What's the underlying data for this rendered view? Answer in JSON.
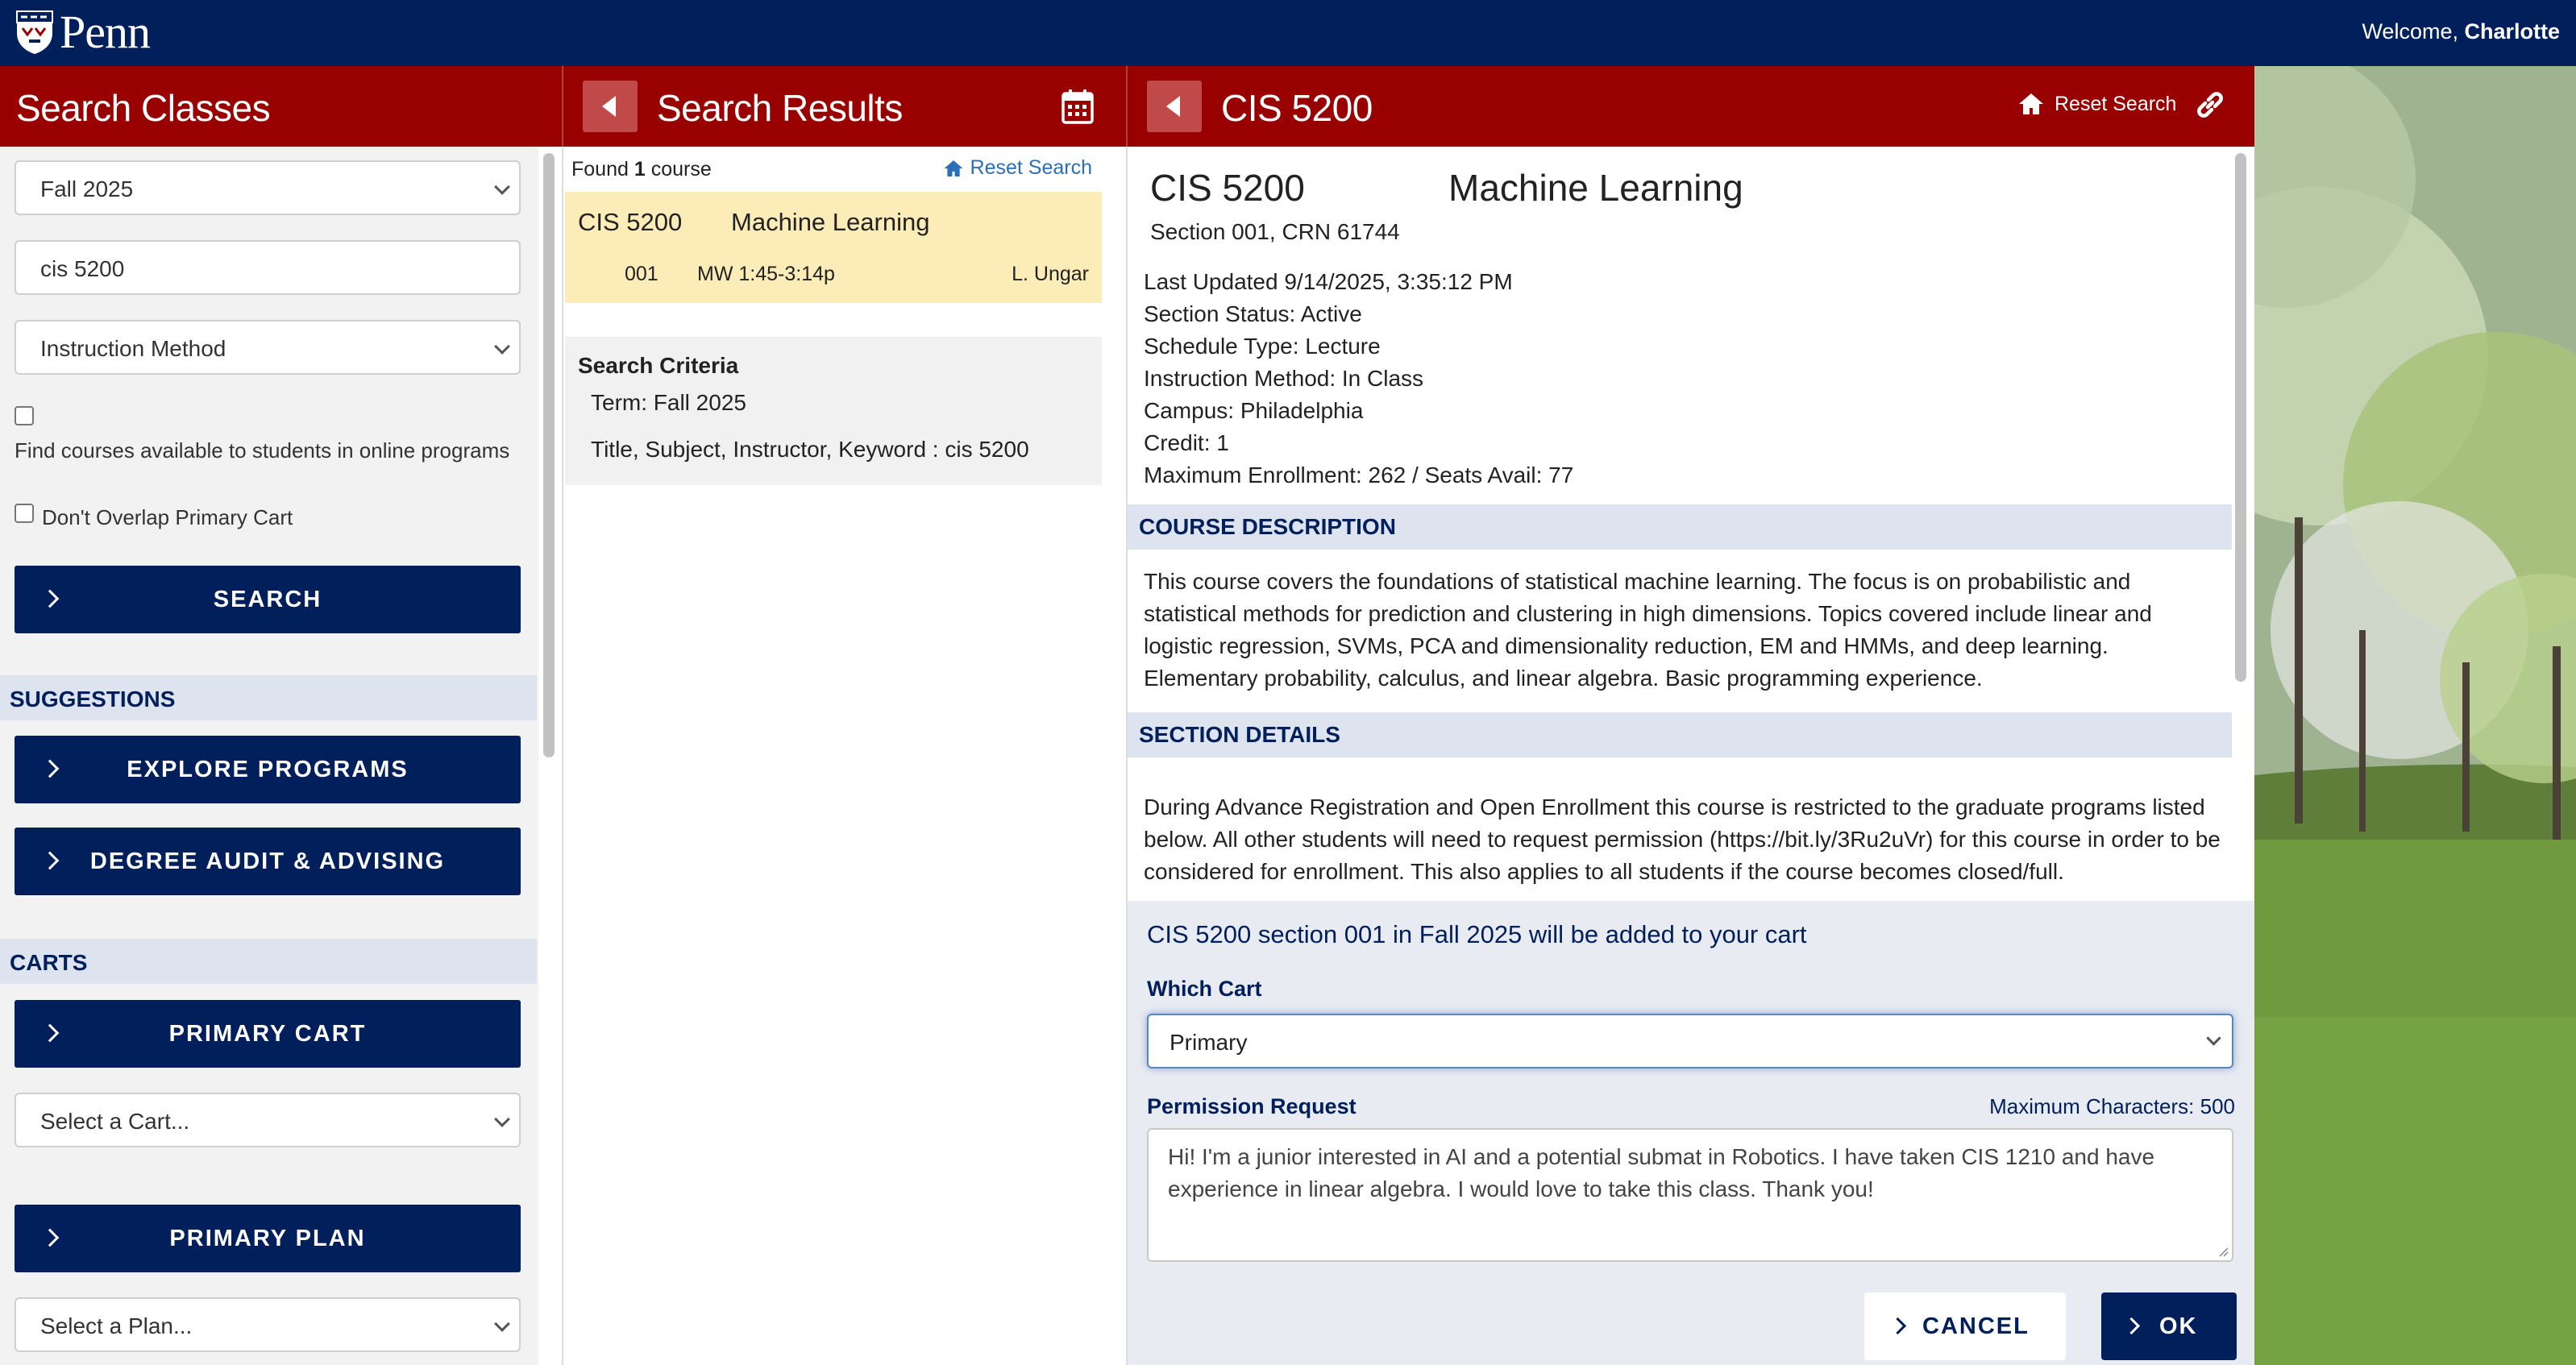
{
  "header": {
    "logo_text": "Penn",
    "welcome_prefix": "Welcome, ",
    "welcome_name": "Charlotte"
  },
  "search_panel": {
    "title": "Search Classes",
    "term_value": "Fall 2025",
    "search_value": "cis 5200",
    "instruction_method": "Instruction Method",
    "online_label": "Find courses available to students in online programs",
    "overlap_label": "Don't Overlap Primary Cart",
    "search_button": "SEARCH",
    "suggestions_heading": "SUGGESTIONS",
    "explore_button": "EXPLORE PROGRAMS",
    "audit_button": "DEGREE AUDIT & ADVISING",
    "carts_heading": "CARTS",
    "primary_cart_button": "PRIMARY CART",
    "cart_select": "Select a Cart...",
    "primary_plan_button": "PRIMARY PLAN",
    "plan_select": "Select a Plan..."
  },
  "results_panel": {
    "title": "Search Results",
    "found_prefix": "Found ",
    "found_count": "1",
    "found_suffix": " course",
    "reset_link": "Reset Search",
    "result": {
      "code": "CIS 5200",
      "name": "Machine Learning",
      "section": "001",
      "time": "MW 1:45-3:14p",
      "instructor": "L. Ungar"
    },
    "criteria_heading": "Search Criteria",
    "criteria_term": "Term: Fall 2025",
    "criteria_keyword": "Title, Subject, Instructor, Keyword : cis 5200"
  },
  "detail_panel": {
    "title": "CIS 5200",
    "reset_link": "Reset Search",
    "course_code": "CIS 5200",
    "course_name": "Machine Learning",
    "section_crn": "Section 001, CRN 61744",
    "last_updated": "Last Updated 9/14/2025, 3:35:12 PM",
    "status": "Section Status: Active",
    "schedule_type": "Schedule Type: Lecture",
    "instruction_method": "Instruction Method: In Class",
    "campus": "Campus: Philadelphia",
    "credit": "Credit: 1",
    "enrollment": "Maximum Enrollment: 262 / Seats Avail: 77",
    "desc_heading": "COURSE DESCRIPTION",
    "desc_text": "This course covers the foundations of statistical machine learning. The focus is on probabilistic and statistical methods for prediction and clustering in high dimensions. Topics covered include linear and logistic regression, SVMs, PCA and dimensionality reduction, EM and HMMs, and deep learning. Elementary probability, calculus, and linear algebra. Basic programming experience.",
    "details_heading": "SECTION DETAILS",
    "details_text": "During Advance Registration and Open Enrollment this course is restricted to the graduate programs listed below. All other students will need to request permission (https://bit.ly/3Ru2uVr) for this course in order to be considered for enrollment. This also applies to all students if the course becomes closed/full."
  },
  "cart_dialog": {
    "message": "CIS 5200 section 001 in Fall 2025 will be added to your cart",
    "which_cart_label": "Which Cart",
    "which_cart_value": "Primary",
    "permission_label": "Permission Request",
    "max_chars": "Maximum Characters: 500",
    "permission_text": "Hi! I'm a junior interested in AI and a potential submat in Robotics. I have taken CIS 1210 and have experience in linear algebra. I would love to take this class. Thank you!",
    "cancel_button": "CANCEL",
    "ok_button": "OK"
  }
}
